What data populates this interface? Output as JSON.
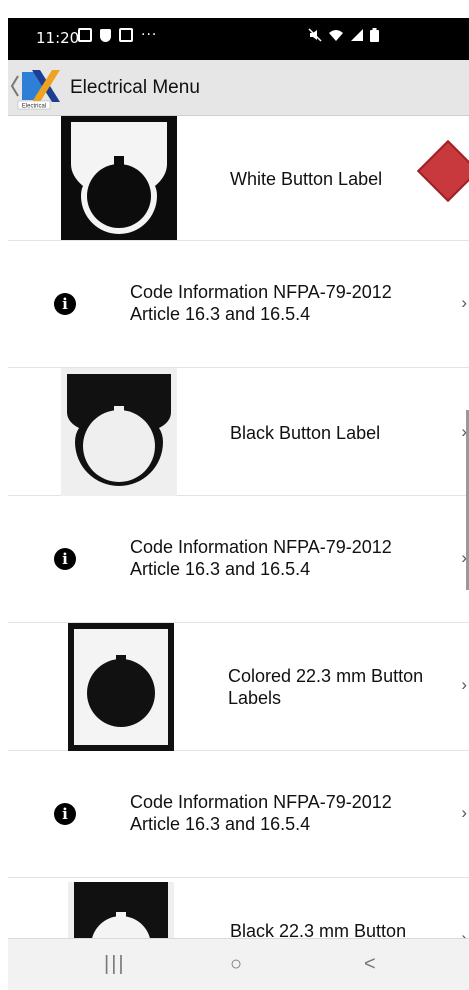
{
  "status_bar": {
    "time": "11:20",
    "left_icons": [
      "gallery-icon",
      "shield-icon",
      "screenshot-icon"
    ],
    "more": "···",
    "right_icons": [
      "mute-icon",
      "wifi-icon",
      "signal-icon",
      "battery-icon"
    ]
  },
  "app_bar": {
    "logo_text": "Electrical",
    "title": "Electrical Menu"
  },
  "list": {
    "items": [
      {
        "type": "label",
        "text": "White Button Label"
      },
      {
        "type": "info",
        "line1": "Code Information NFPA-79-2012",
        "line2": "Article 16.3 and 16.5.4"
      },
      {
        "type": "label",
        "text": "Black Button Label"
      },
      {
        "type": "info",
        "line1": "Code Information NFPA-79-2012",
        "line2": "Article 16.3 and 16.5.4"
      },
      {
        "type": "label",
        "line1": "Colored 22.3 mm Button",
        "line2": "Labels"
      },
      {
        "type": "info",
        "line1": "Code Information NFPA-79-2012",
        "line2": "Article 16.3 and 16.5.4"
      },
      {
        "type": "label",
        "text": "Black 22.3 mm Button"
      }
    ],
    "chevron": "›"
  },
  "nav_bar": {
    "recents": "|||",
    "home": "○",
    "back": "<"
  },
  "colors": {
    "app_bar": "#e6e6e6",
    "status_bar": "#000000",
    "marker": "#c8393d"
  }
}
